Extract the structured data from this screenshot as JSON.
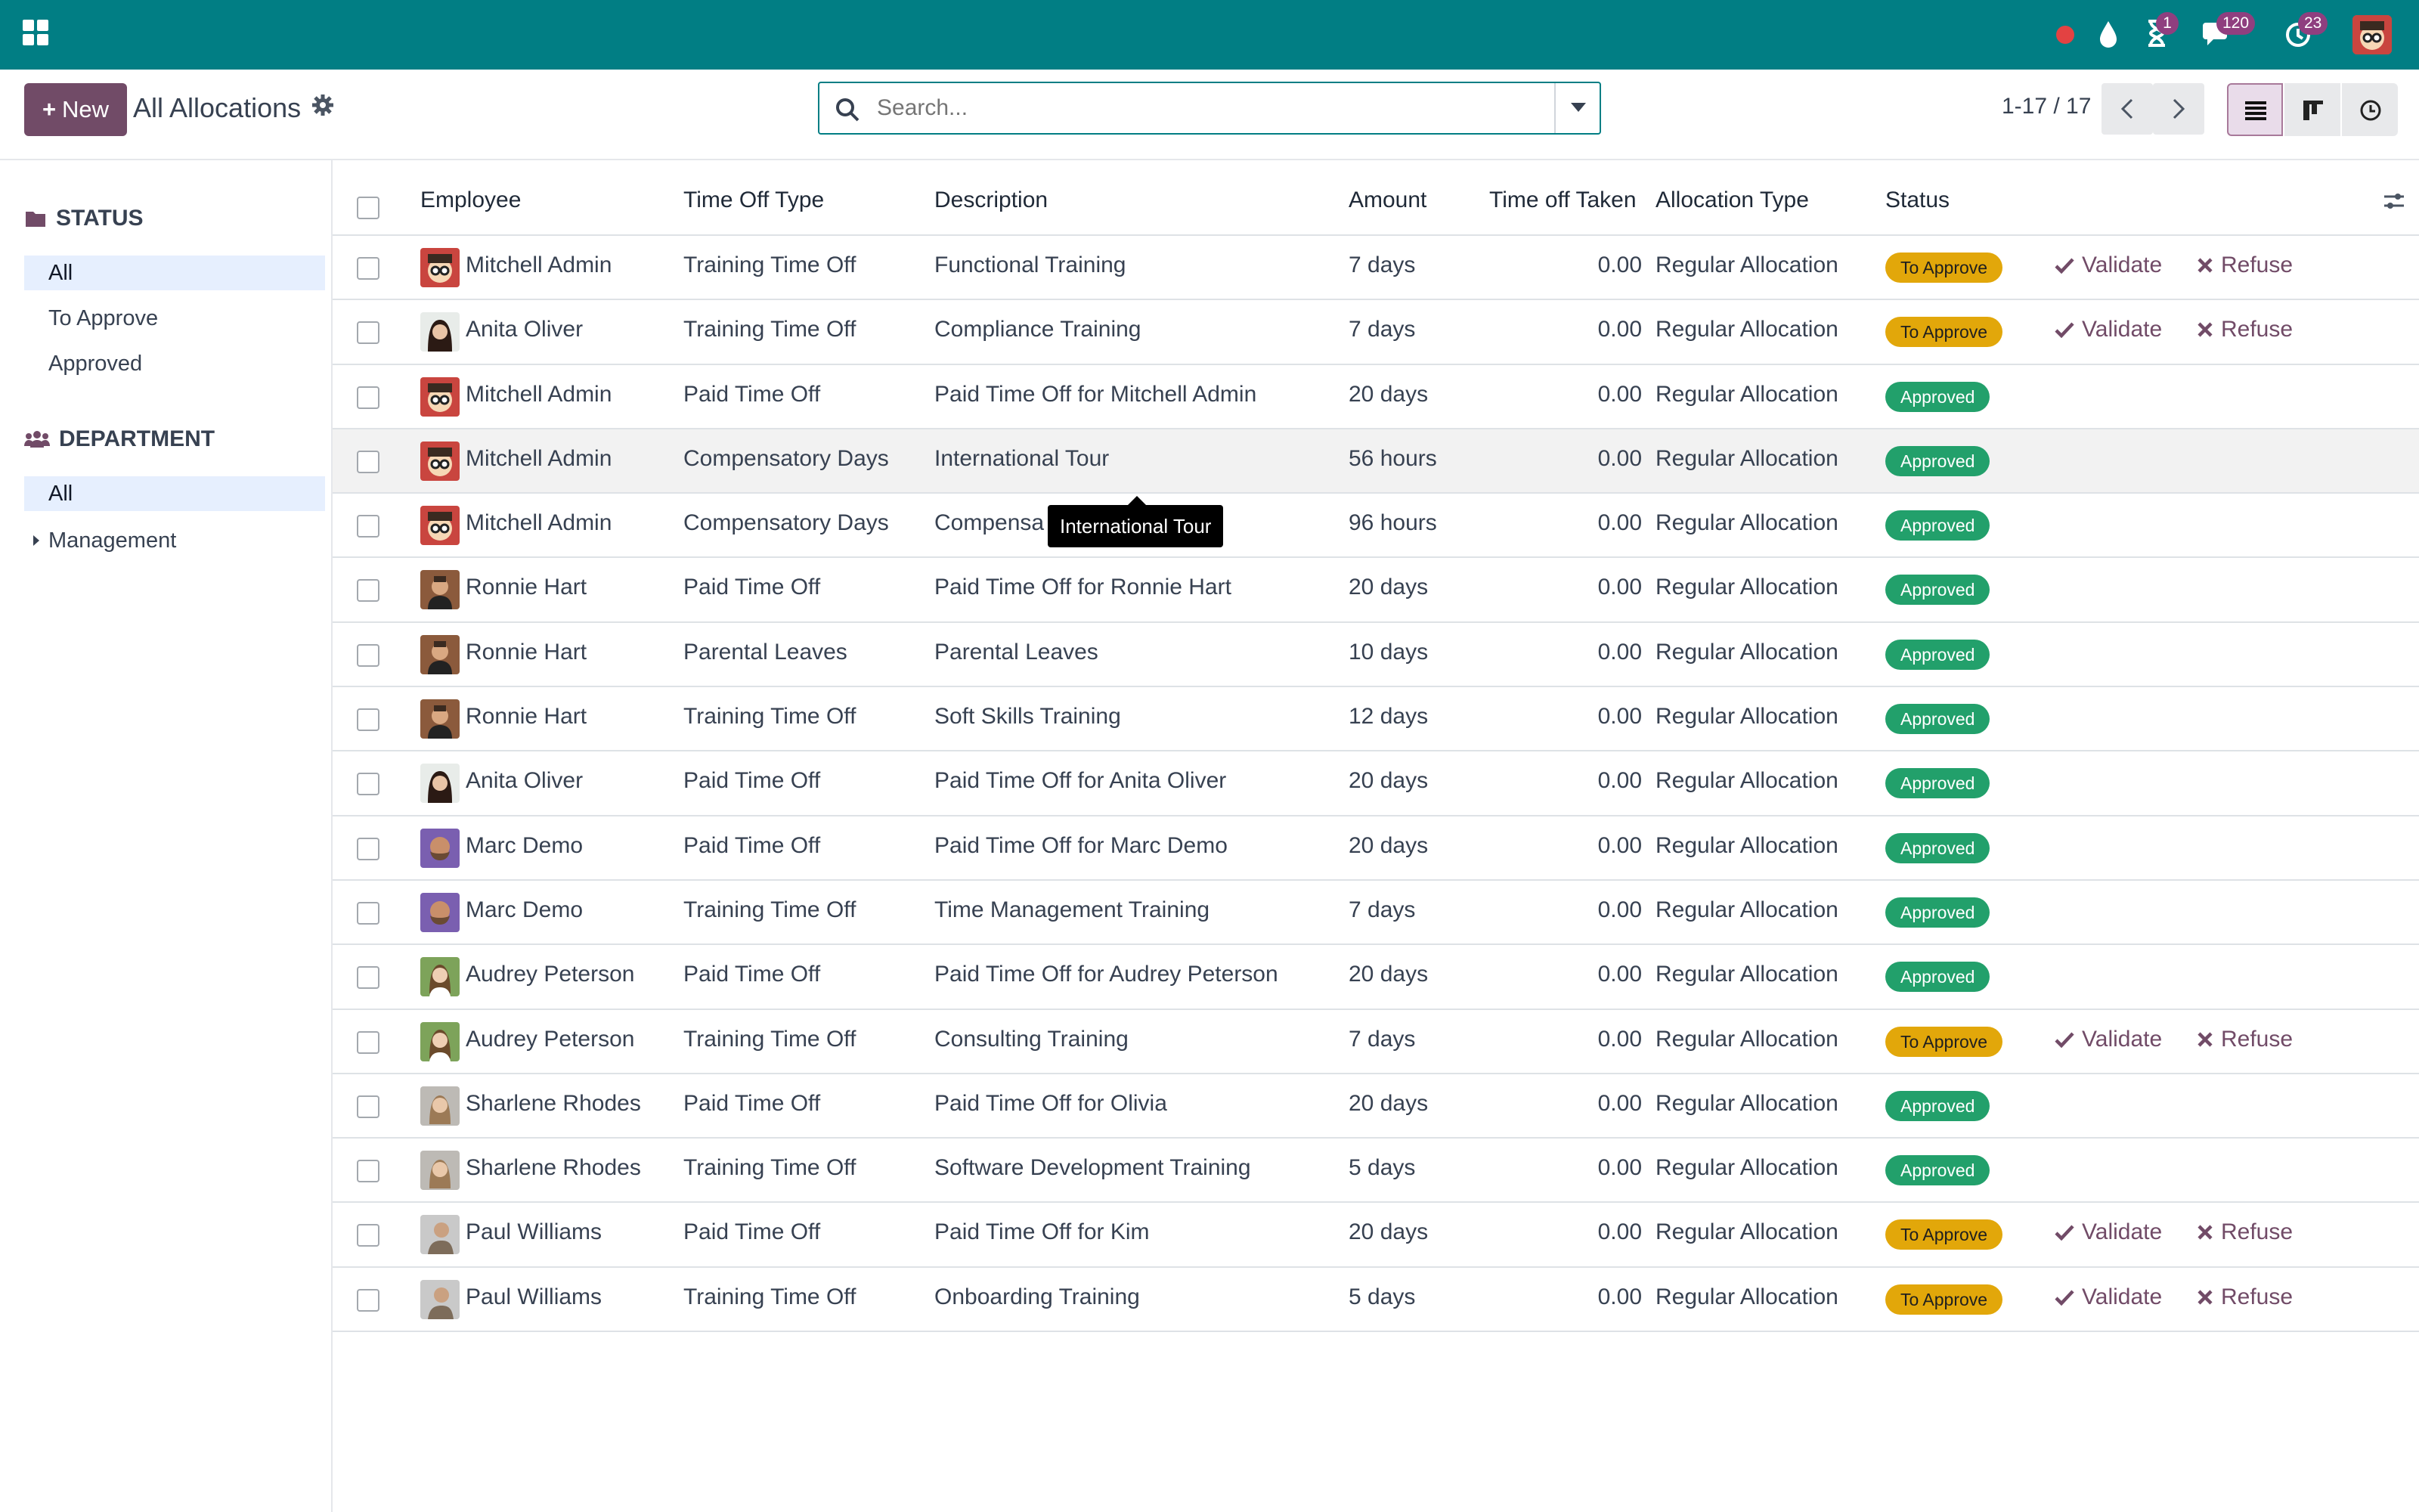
{
  "navbar": {
    "badges": {
      "activity": "1",
      "messages": "120",
      "timer": "23"
    }
  },
  "control": {
    "new_label": "New",
    "title": "All Allocations",
    "search_placeholder": "Search...",
    "pager": "1-17 / 17"
  },
  "sidebar": {
    "status_heading": "STATUS",
    "status_items": [
      "All",
      "To Approve",
      "Approved"
    ],
    "department_heading": "DEPARTMENT",
    "department_items": [
      "All",
      "Management"
    ]
  },
  "table": {
    "columns": [
      "Employee",
      "Time Off Type",
      "Description",
      "Amount",
      "Time off Taken",
      "Allocation Type",
      "Status"
    ],
    "action_validate": "Validate",
    "action_refuse": "Refuse",
    "rows": [
      {
        "employee": "Mitchell Admin",
        "type": "Training Time Off",
        "description": "Functional Training",
        "amount": "7 days",
        "taken": "0.00",
        "alloc": "Regular Allocation",
        "status": "To Approve",
        "avatar": "mitchell"
      },
      {
        "employee": "Anita Oliver",
        "type": "Training Time Off",
        "description": "Compliance Training",
        "amount": "7 days",
        "taken": "0.00",
        "alloc": "Regular Allocation",
        "status": "To Approve",
        "avatar": "anita"
      },
      {
        "employee": "Mitchell Admin",
        "type": "Paid Time Off",
        "description": "Paid Time Off for Mitchell Admin",
        "amount": "20 days",
        "taken": "0.00",
        "alloc": "Regular Allocation",
        "status": "Approved",
        "avatar": "mitchell"
      },
      {
        "employee": "Mitchell Admin",
        "type": "Compensatory Days",
        "description": "International Tour",
        "amount": "56 hours",
        "taken": "0.00",
        "alloc": "Regular Allocation",
        "status": "Approved",
        "avatar": "mitchell"
      },
      {
        "employee": "Mitchell Admin",
        "type": "Compensatory Days",
        "description": "Compensa",
        "amount": "96 hours",
        "taken": "0.00",
        "alloc": "Regular Allocation",
        "status": "Approved",
        "avatar": "mitchell"
      },
      {
        "employee": "Ronnie Hart",
        "type": "Paid Time Off",
        "description": "Paid Time Off for Ronnie Hart",
        "amount": "20 days",
        "taken": "0.00",
        "alloc": "Regular Allocation",
        "status": "Approved",
        "avatar": "ronnie"
      },
      {
        "employee": "Ronnie Hart",
        "type": "Parental Leaves",
        "description": "Parental Leaves",
        "amount": "10 days",
        "taken": "0.00",
        "alloc": "Regular Allocation",
        "status": "Approved",
        "avatar": "ronnie"
      },
      {
        "employee": "Ronnie Hart",
        "type": "Training Time Off",
        "description": "Soft Skills Training",
        "amount": "12 days",
        "taken": "0.00",
        "alloc": "Regular Allocation",
        "status": "Approved",
        "avatar": "ronnie"
      },
      {
        "employee": "Anita Oliver",
        "type": "Paid Time Off",
        "description": "Paid Time Off for Anita Oliver",
        "amount": "20 days",
        "taken": "0.00",
        "alloc": "Regular Allocation",
        "status": "Approved",
        "avatar": "anita"
      },
      {
        "employee": "Marc Demo",
        "type": "Paid Time Off",
        "description": "Paid Time Off for Marc Demo",
        "amount": "20 days",
        "taken": "0.00",
        "alloc": "Regular Allocation",
        "status": "Approved",
        "avatar": "marc"
      },
      {
        "employee": "Marc Demo",
        "type": "Training Time Off",
        "description": "Time Management Training",
        "amount": "7 days",
        "taken": "0.00",
        "alloc": "Regular Allocation",
        "status": "Approved",
        "avatar": "marc"
      },
      {
        "employee": "Audrey Peterson",
        "type": "Paid Time Off",
        "description": "Paid Time Off for Audrey Peterson",
        "amount": "20 days",
        "taken": "0.00",
        "alloc": "Regular Allocation",
        "status": "Approved",
        "avatar": "audrey"
      },
      {
        "employee": "Audrey Peterson",
        "type": "Training Time Off",
        "description": "Consulting Training",
        "amount": "7 days",
        "taken": "0.00",
        "alloc": "Regular Allocation",
        "status": "To Approve",
        "avatar": "audrey"
      },
      {
        "employee": "Sharlene Rhodes",
        "type": "Paid Time Off",
        "description": "Paid Time Off for Olivia",
        "amount": "20 days",
        "taken": "0.00",
        "alloc": "Regular Allocation",
        "status": "Approved",
        "avatar": "sharlene"
      },
      {
        "employee": "Sharlene Rhodes",
        "type": "Training Time Off",
        "description": "Software Development Training",
        "amount": "5 days",
        "taken": "0.00",
        "alloc": "Regular Allocation",
        "status": "Approved",
        "avatar": "sharlene"
      },
      {
        "employee": "Paul Williams",
        "type": "Paid Time Off",
        "description": "Paid Time Off for Kim",
        "amount": "20 days",
        "taken": "0.00",
        "alloc": "Regular Allocation",
        "status": "To Approve",
        "avatar": "paul"
      },
      {
        "employee": "Paul Williams",
        "type": "Training Time Off",
        "description": "Onboarding Training",
        "amount": "5 days",
        "taken": "0.00",
        "alloc": "Regular Allocation",
        "status": "To Approve",
        "avatar": "paul"
      }
    ]
  },
  "tooltip": {
    "text": "International Tour"
  },
  "colors": {
    "navbar": "#017e84",
    "primary": "#714b67",
    "to_approve": "#e2a70a",
    "approved": "#22a06b"
  }
}
